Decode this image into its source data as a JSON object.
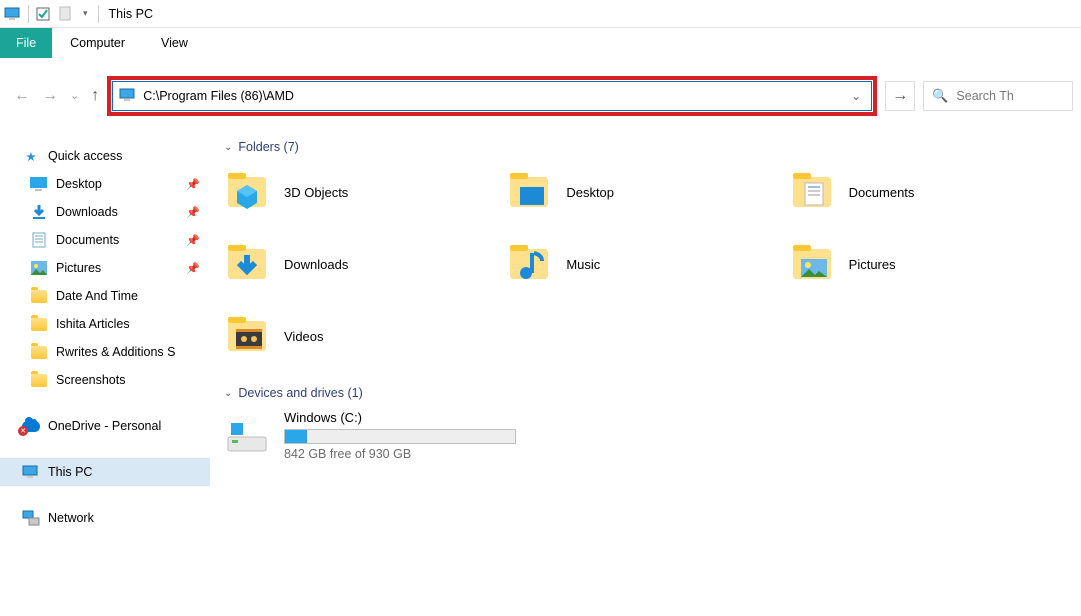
{
  "window": {
    "title": "This PC"
  },
  "menu": {
    "file": "File",
    "computer": "Computer",
    "view": "View"
  },
  "address": {
    "path": "C:\\Program Files (86)\\AMD",
    "search_placeholder": "Search Th"
  },
  "sidebar": {
    "quick_access": "Quick access",
    "items": [
      {
        "label": "Desktop",
        "pinned": true,
        "icon": "desktop"
      },
      {
        "label": "Downloads",
        "pinned": true,
        "icon": "download"
      },
      {
        "label": "Documents",
        "pinned": true,
        "icon": "document"
      },
      {
        "label": "Pictures",
        "pinned": true,
        "icon": "picture"
      },
      {
        "label": "Date And Time",
        "pinned": false,
        "icon": "folder"
      },
      {
        "label": "Ishita Articles",
        "pinned": false,
        "icon": "folder"
      },
      {
        "label": "Rwrites & Additions S",
        "pinned": false,
        "icon": "folder"
      },
      {
        "label": "Screenshots",
        "pinned": false,
        "icon": "folder"
      }
    ],
    "onedrive": "OneDrive - Personal",
    "this_pc": "This PC",
    "network": "Network"
  },
  "groups": {
    "folders_label": "Folders (7)",
    "folders": [
      {
        "name": "3D Objects"
      },
      {
        "name": "Desktop"
      },
      {
        "name": "Documents"
      },
      {
        "name": "Downloads"
      },
      {
        "name": "Music"
      },
      {
        "name": "Pictures"
      },
      {
        "name": "Videos"
      }
    ],
    "drives_label": "Devices and drives (1)",
    "drive": {
      "name": "Windows (C:)",
      "free_text": "842 GB free of 930 GB",
      "used_percent": 9.5
    }
  }
}
